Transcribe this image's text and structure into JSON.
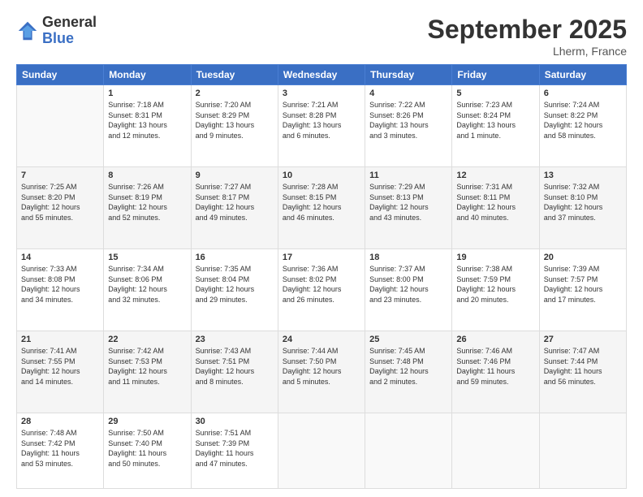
{
  "logo": {
    "general": "General",
    "blue": "Blue"
  },
  "header": {
    "month": "September 2025",
    "location": "Lherm, France"
  },
  "days": [
    "Sunday",
    "Monday",
    "Tuesday",
    "Wednesday",
    "Thursday",
    "Friday",
    "Saturday"
  ],
  "weeks": [
    [
      {
        "day": "",
        "content": ""
      },
      {
        "day": "1",
        "content": "Sunrise: 7:18 AM\nSunset: 8:31 PM\nDaylight: 13 hours\nand 12 minutes."
      },
      {
        "day": "2",
        "content": "Sunrise: 7:20 AM\nSunset: 8:29 PM\nDaylight: 13 hours\nand 9 minutes."
      },
      {
        "day": "3",
        "content": "Sunrise: 7:21 AM\nSunset: 8:28 PM\nDaylight: 13 hours\nand 6 minutes."
      },
      {
        "day": "4",
        "content": "Sunrise: 7:22 AM\nSunset: 8:26 PM\nDaylight: 13 hours\nand 3 minutes."
      },
      {
        "day": "5",
        "content": "Sunrise: 7:23 AM\nSunset: 8:24 PM\nDaylight: 13 hours\nand 1 minute."
      },
      {
        "day": "6",
        "content": "Sunrise: 7:24 AM\nSunset: 8:22 PM\nDaylight: 12 hours\nand 58 minutes."
      }
    ],
    [
      {
        "day": "7",
        "content": "Sunrise: 7:25 AM\nSunset: 8:20 PM\nDaylight: 12 hours\nand 55 minutes."
      },
      {
        "day": "8",
        "content": "Sunrise: 7:26 AM\nSunset: 8:19 PM\nDaylight: 12 hours\nand 52 minutes."
      },
      {
        "day": "9",
        "content": "Sunrise: 7:27 AM\nSunset: 8:17 PM\nDaylight: 12 hours\nand 49 minutes."
      },
      {
        "day": "10",
        "content": "Sunrise: 7:28 AM\nSunset: 8:15 PM\nDaylight: 12 hours\nand 46 minutes."
      },
      {
        "day": "11",
        "content": "Sunrise: 7:29 AM\nSunset: 8:13 PM\nDaylight: 12 hours\nand 43 minutes."
      },
      {
        "day": "12",
        "content": "Sunrise: 7:31 AM\nSunset: 8:11 PM\nDaylight: 12 hours\nand 40 minutes."
      },
      {
        "day": "13",
        "content": "Sunrise: 7:32 AM\nSunset: 8:10 PM\nDaylight: 12 hours\nand 37 minutes."
      }
    ],
    [
      {
        "day": "14",
        "content": "Sunrise: 7:33 AM\nSunset: 8:08 PM\nDaylight: 12 hours\nand 34 minutes."
      },
      {
        "day": "15",
        "content": "Sunrise: 7:34 AM\nSunset: 8:06 PM\nDaylight: 12 hours\nand 32 minutes."
      },
      {
        "day": "16",
        "content": "Sunrise: 7:35 AM\nSunset: 8:04 PM\nDaylight: 12 hours\nand 29 minutes."
      },
      {
        "day": "17",
        "content": "Sunrise: 7:36 AM\nSunset: 8:02 PM\nDaylight: 12 hours\nand 26 minutes."
      },
      {
        "day": "18",
        "content": "Sunrise: 7:37 AM\nSunset: 8:00 PM\nDaylight: 12 hours\nand 23 minutes."
      },
      {
        "day": "19",
        "content": "Sunrise: 7:38 AM\nSunset: 7:59 PM\nDaylight: 12 hours\nand 20 minutes."
      },
      {
        "day": "20",
        "content": "Sunrise: 7:39 AM\nSunset: 7:57 PM\nDaylight: 12 hours\nand 17 minutes."
      }
    ],
    [
      {
        "day": "21",
        "content": "Sunrise: 7:41 AM\nSunset: 7:55 PM\nDaylight: 12 hours\nand 14 minutes."
      },
      {
        "day": "22",
        "content": "Sunrise: 7:42 AM\nSunset: 7:53 PM\nDaylight: 12 hours\nand 11 minutes."
      },
      {
        "day": "23",
        "content": "Sunrise: 7:43 AM\nSunset: 7:51 PM\nDaylight: 12 hours\nand 8 minutes."
      },
      {
        "day": "24",
        "content": "Sunrise: 7:44 AM\nSunset: 7:50 PM\nDaylight: 12 hours\nand 5 minutes."
      },
      {
        "day": "25",
        "content": "Sunrise: 7:45 AM\nSunset: 7:48 PM\nDaylight: 12 hours\nand 2 minutes."
      },
      {
        "day": "26",
        "content": "Sunrise: 7:46 AM\nSunset: 7:46 PM\nDaylight: 11 hours\nand 59 minutes."
      },
      {
        "day": "27",
        "content": "Sunrise: 7:47 AM\nSunset: 7:44 PM\nDaylight: 11 hours\nand 56 minutes."
      }
    ],
    [
      {
        "day": "28",
        "content": "Sunrise: 7:48 AM\nSunset: 7:42 PM\nDaylight: 11 hours\nand 53 minutes."
      },
      {
        "day": "29",
        "content": "Sunrise: 7:50 AM\nSunset: 7:40 PM\nDaylight: 11 hours\nand 50 minutes."
      },
      {
        "day": "30",
        "content": "Sunrise: 7:51 AM\nSunset: 7:39 PM\nDaylight: 11 hours\nand 47 minutes."
      },
      {
        "day": "",
        "content": ""
      },
      {
        "day": "",
        "content": ""
      },
      {
        "day": "",
        "content": ""
      },
      {
        "day": "",
        "content": ""
      }
    ]
  ]
}
